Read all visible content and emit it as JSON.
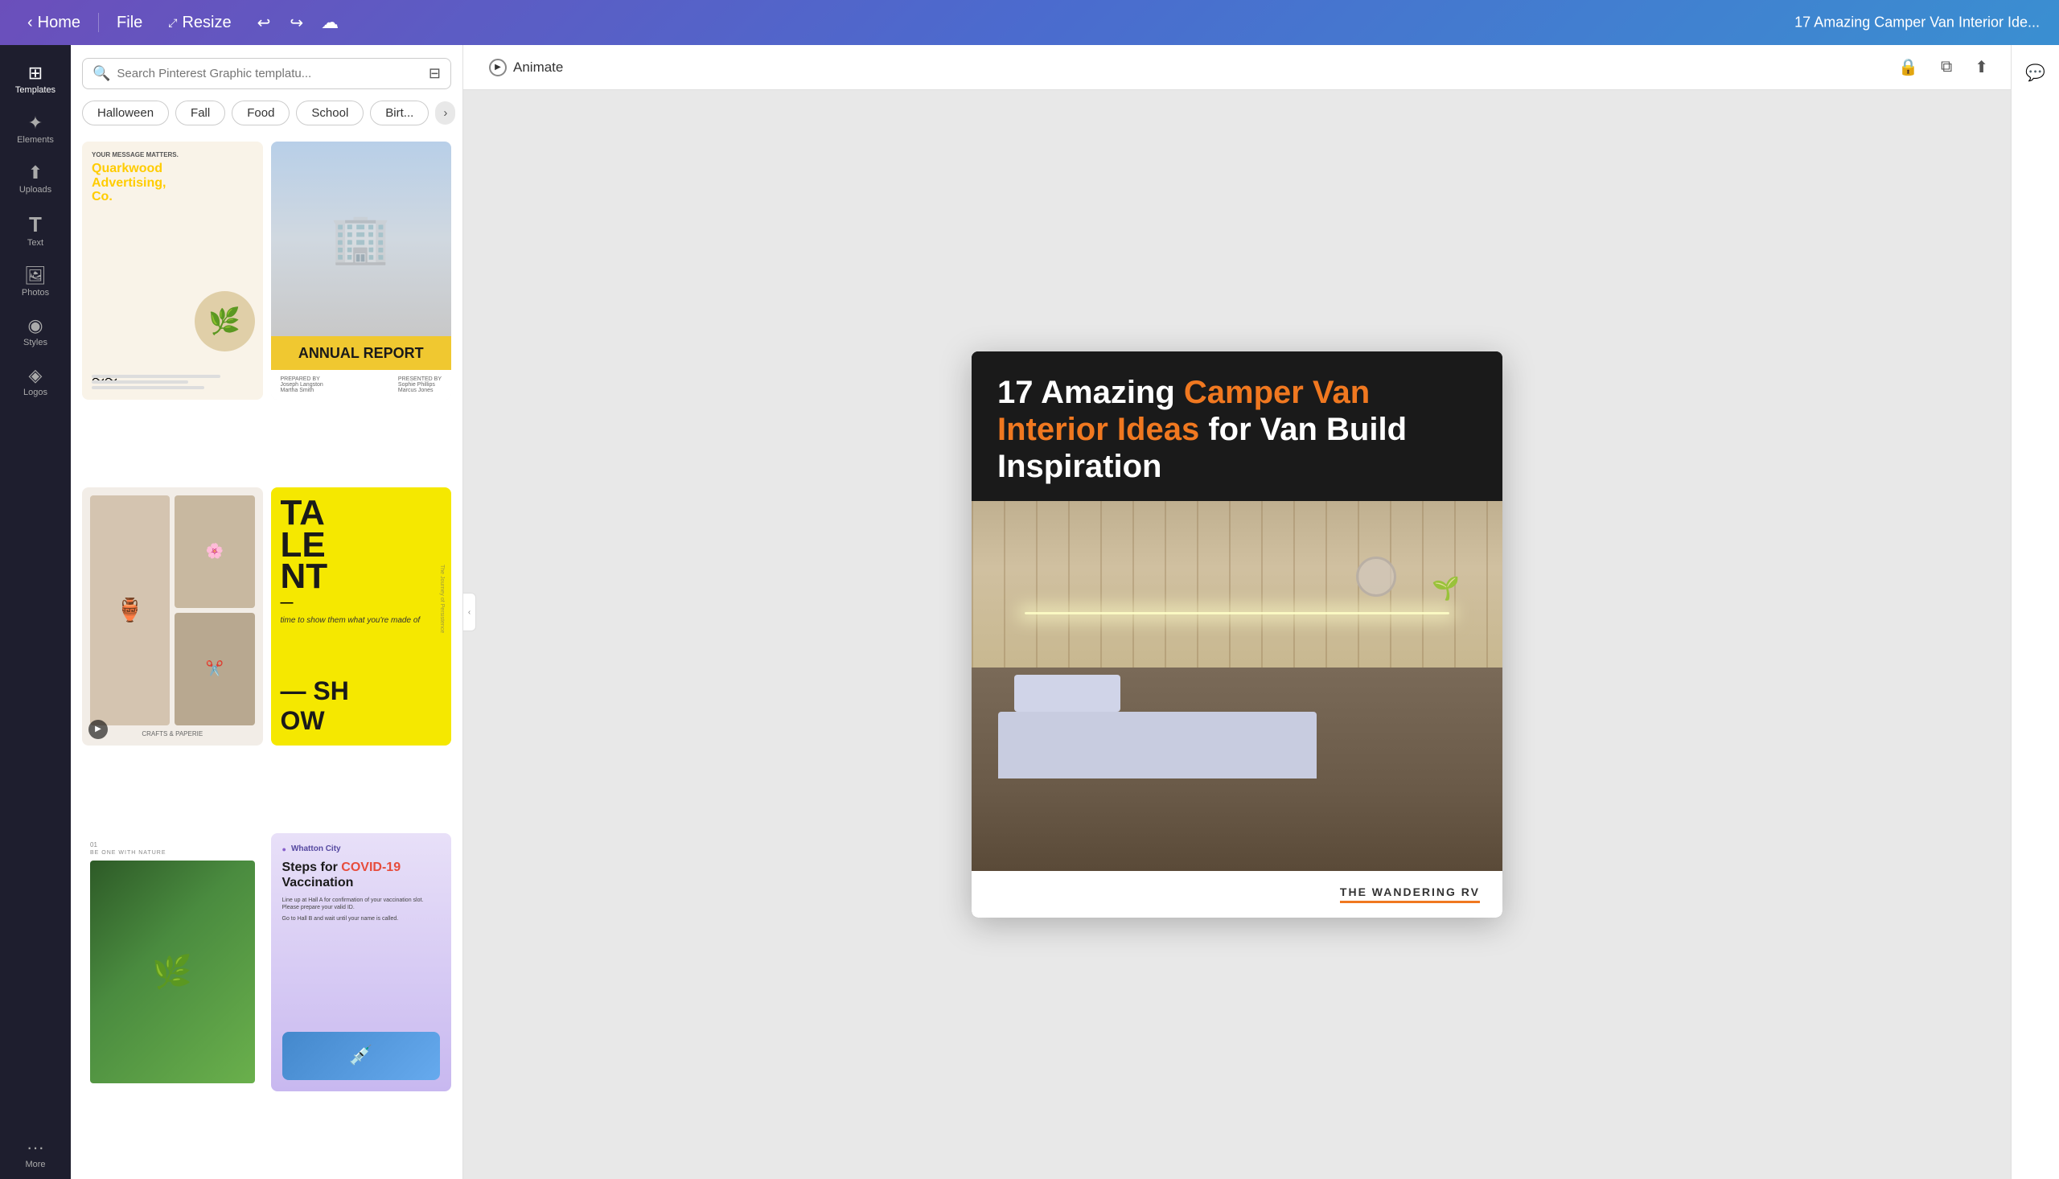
{
  "topbar": {
    "home_label": "Home",
    "file_label": "File",
    "resize_label": "Resize",
    "title": "17 Amazing Camper Van Interior Ide...",
    "undo_icon": "↩",
    "redo_icon": "↪",
    "cloud_icon": "☁"
  },
  "sidebar": {
    "items": [
      {
        "id": "templates",
        "icon": "⊞",
        "label": "Templates",
        "active": true
      },
      {
        "id": "elements",
        "icon": "✦",
        "label": "Elements"
      },
      {
        "id": "uploads",
        "icon": "⬆",
        "label": "Uploads"
      },
      {
        "id": "text",
        "icon": "T",
        "label": "Text"
      },
      {
        "id": "photos",
        "icon": "🖼",
        "label": "Photos"
      },
      {
        "id": "styles",
        "icon": "◉",
        "label": "Styles"
      },
      {
        "id": "logos",
        "icon": "◈",
        "label": "Logos"
      },
      {
        "id": "more",
        "icon": "•••",
        "label": "More"
      }
    ]
  },
  "search": {
    "placeholder": "Search Pinterest Graphic templatu...",
    "value": ""
  },
  "chips": [
    {
      "id": "halloween",
      "label": "Halloween"
    },
    {
      "id": "fall",
      "label": "Fall"
    },
    {
      "id": "food",
      "label": "Food"
    },
    {
      "id": "school",
      "label": "School"
    },
    {
      "id": "birthday",
      "label": "Birt..."
    }
  ],
  "templates": [
    {
      "id": "ad",
      "type": "advertising",
      "company": "Quarkwood Advertising, Co.",
      "tagline": "YOUR MESSAGE MATTERS."
    },
    {
      "id": "annual",
      "type": "report",
      "title": "ANNUAL REPORT"
    },
    {
      "id": "crafts",
      "type": "lifestyle",
      "brand": "CRAFTS & PAPERIE"
    },
    {
      "id": "talent",
      "type": "event",
      "text": "TA LE NT",
      "sub": "time to show them what you're made of",
      "show": "– SH OW"
    },
    {
      "id": "nature",
      "type": "nature",
      "number": "01",
      "tag": "BE ONE WITH NATURE"
    },
    {
      "id": "vaccine",
      "type": "health",
      "org": "Whatton City",
      "title_start": "Steps for ",
      "title_highlight": "COVID-19",
      "title_end": " Vaccination"
    }
  ],
  "canvas": {
    "animate_label": "Animate",
    "animate_icon": "▶"
  },
  "pinterest_card": {
    "title_start": "17 Amazing ",
    "title_highlight": "Camper Van Interior Ideas",
    "title_end": " for Van Build Inspiration",
    "brand_name": "THE WANDERING RV",
    "accent_color": "#f07820"
  }
}
